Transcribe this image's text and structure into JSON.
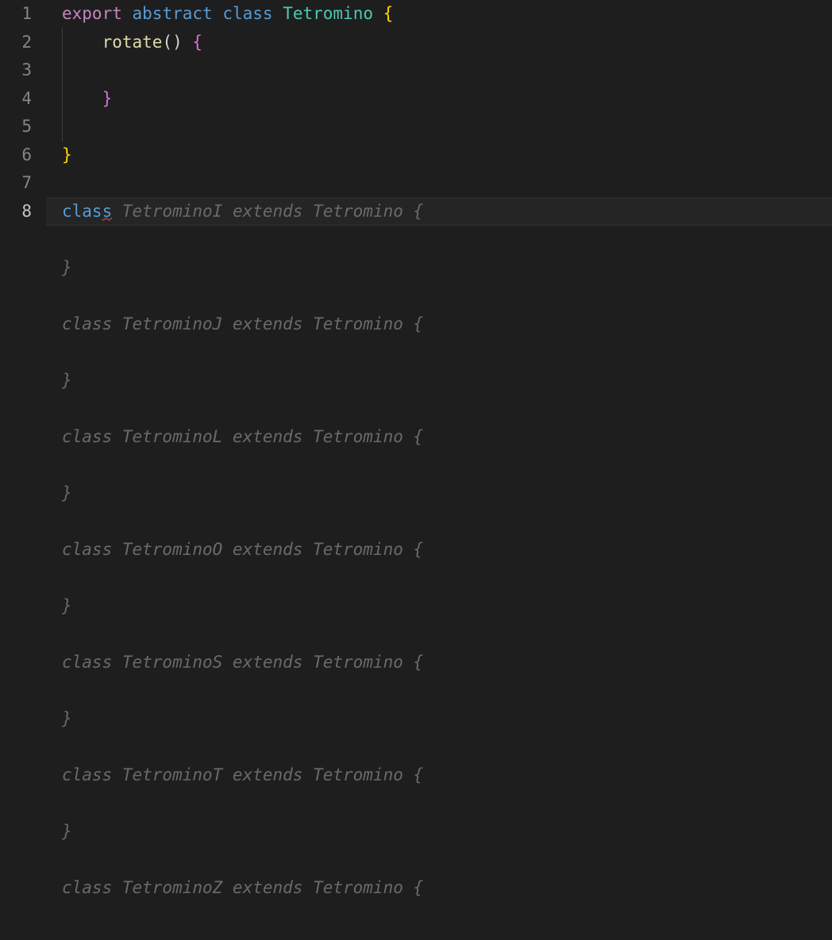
{
  "gutter": {
    "lines": [
      "1",
      "2",
      "3",
      "4",
      "5",
      "6",
      "7",
      "8"
    ],
    "activeLine": "8"
  },
  "code": {
    "line1": {
      "t1": "export",
      "t2": " ",
      "t3": "abstract",
      "t4": " ",
      "t5": "class",
      "t6": " ",
      "t7": "Tetromino",
      "t8": " ",
      "t9": "{"
    },
    "line2": {
      "indent": "    ",
      "t1": "rotate",
      "t2": "()",
      "t3": " ",
      "t4": "{"
    },
    "line3": {
      "indent": ""
    },
    "line4": {
      "indent": "    ",
      "t1": "}"
    },
    "line5": {
      "indent": ""
    },
    "line6": {
      "t1": "}"
    },
    "line7": {
      "indent": ""
    },
    "line8": {
      "typed_t1": "clas",
      "typed_t2": "s",
      "ghost": " TetrominoI extends Tetromino {"
    }
  },
  "ghost": {
    "g1": "",
    "g2": "}",
    "g3": "",
    "g4": "class TetrominoJ extends Tetromino {",
    "g5": "",
    "g6": "}",
    "g7": "",
    "g8": "class TetrominoL extends Tetromino {",
    "g9": "",
    "g10": "}",
    "g11": "",
    "g12": "class TetrominoO extends Tetromino {",
    "g13": "",
    "g14": "}",
    "g15": "",
    "g16": "class TetrominoS extends Tetromino {",
    "g17": "",
    "g18": "}",
    "g19": "",
    "g20": "class TetrominoT extends Tetromino {",
    "g21": "",
    "g22": "}",
    "g23": "",
    "g24": "class TetrominoZ extends Tetromino {"
  }
}
